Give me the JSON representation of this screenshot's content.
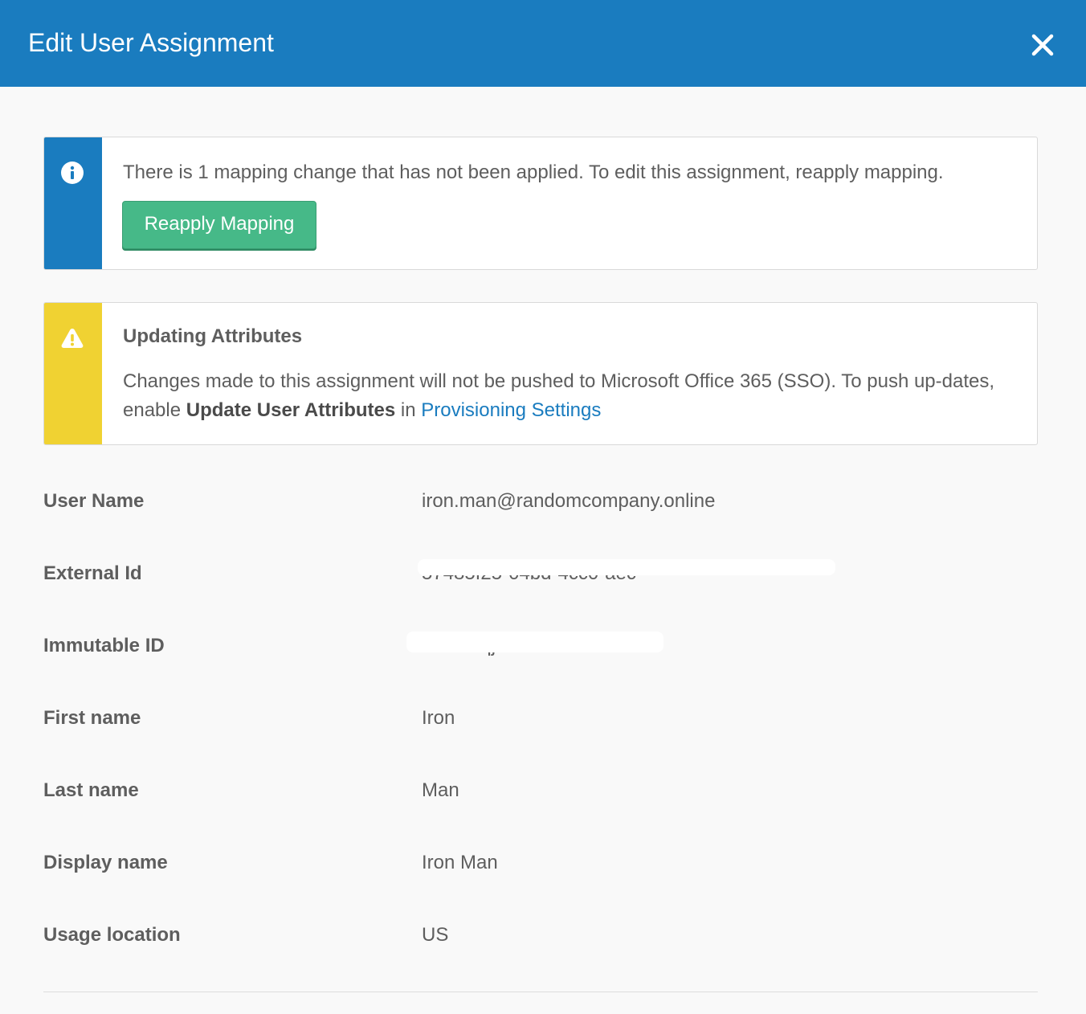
{
  "header": {
    "title": "Edit User Assignment",
    "close_icon": "close-icon"
  },
  "info_callout": {
    "icon": "info-icon",
    "message": "There is 1 mapping change that has not been applied. To edit this assignment, reapply mapping.",
    "button_label": "Reapply Mapping"
  },
  "warning_callout": {
    "icon": "warning-icon",
    "title": "Updating Attributes",
    "body_prefix": "Changes made to this assignment will not be pushed to Microsoft Office 365 (SSO). To push up-dates, enable ",
    "body_bold": "Update User Attributes",
    "body_mid": " in ",
    "link_label": "Provisioning Settings"
  },
  "attributes": [
    {
      "label": "User Name",
      "value": "iron.man@randomcompany.online"
    },
    {
      "label": "External Id",
      "value": "57485f25-04bd-4cc0-aec"
    },
    {
      "label": "Immutable ID",
      "value": "0dd7mqjn0iF1Md522t7"
    },
    {
      "label": "First name",
      "value": "Iron"
    },
    {
      "label": "Last name",
      "value": "Man"
    },
    {
      "label": "Display name",
      "value": "Iron Man"
    },
    {
      "label": "Usage location",
      "value": "US"
    }
  ],
  "colors": {
    "header_bg": "#1a7cbf",
    "info_bar": "#1a7cbf",
    "warning_bar": "#f0d232",
    "button_bg": "#46b988",
    "link": "#1a7cbf"
  }
}
